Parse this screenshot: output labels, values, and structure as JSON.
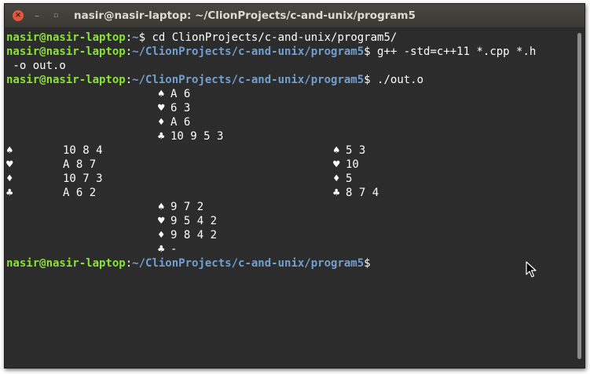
{
  "window": {
    "title": "nasir@nasir-laptop: ~/ClionProjects/c-and-unix/program5",
    "close_icon": "×",
    "minimize_icon": "–",
    "maximize_icon": "▫"
  },
  "prompt": {
    "user": "nasir@nasir-laptop",
    "colon": ":"
  },
  "lines": {
    "l1": {
      "path": "~",
      "dollar": "$",
      "cmd": " cd ClionProjects/c-and-unix/program5/"
    },
    "l2": {
      "path": "~/ClionProjects/c-and-unix/program5",
      "dollar": "$",
      "cmd": " g++ -std=c++11 *.cpp *.h"
    },
    "l3": {
      "text": " -o out.o"
    },
    "l4": {
      "path": "~/ClionProjects/c-and-unix/program5",
      "dollar": "$",
      "cmd": " ./out.o"
    },
    "l_last": {
      "path": "~/ClionProjects/c-and-unix/program5",
      "dollar": "$",
      "cmd": ""
    }
  },
  "hands": {
    "north": {
      "spades": {
        "suit": "♠",
        "cards": "A 6"
      },
      "hearts": {
        "suit": "♥",
        "cards": "6 3"
      },
      "diamonds": {
        "suit": "♦",
        "cards": "A 6"
      },
      "clubs": {
        "suit": "♣",
        "cards": "10 9 5 3"
      }
    },
    "west": {
      "spades": {
        "suit": "♠",
        "cards": "10 8 4"
      },
      "hearts": {
        "suit": "♥",
        "cards": "A 8 7"
      },
      "diamonds": {
        "suit": "♦",
        "cards": "10 7 3"
      },
      "clubs": {
        "suit": "♣",
        "cards": "A 6 2"
      }
    },
    "east": {
      "spades": {
        "suit": "♠",
        "cards": "5 3"
      },
      "hearts": {
        "suit": "♥",
        "cards": "10"
      },
      "diamonds": {
        "suit": "♦",
        "cards": "5"
      },
      "clubs": {
        "suit": "♣",
        "cards": "8 7 4"
      }
    },
    "south": {
      "spades": {
        "suit": "♠",
        "cards": "9 7 2"
      },
      "hearts": {
        "suit": "♥",
        "cards": "9 5 4 2"
      },
      "diamonds": {
        "suit": "♦",
        "cards": "9 8 4 2"
      },
      "clubs": {
        "suit": "♣",
        "cards": "-"
      }
    }
  },
  "colors": {
    "user": "#8ae234",
    "path": "#729fcf",
    "text": "#ffffff",
    "background": "#2c2c2c",
    "close_button": "#e2583d"
  },
  "cursor_icon": "mouse-pointer-icon"
}
